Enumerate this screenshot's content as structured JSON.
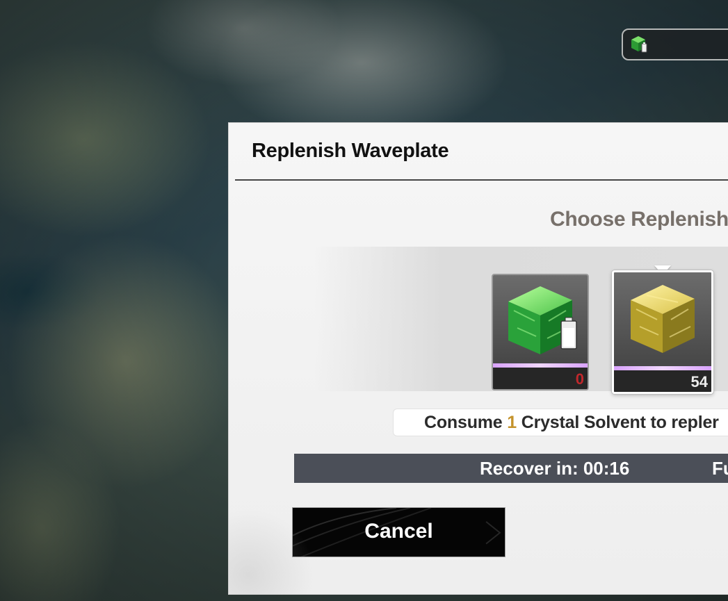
{
  "top_currency": {
    "icon": "waveplate-battery-icon"
  },
  "dialog": {
    "title": "Replenish Waveplate",
    "subtitle": "Choose Replenishr",
    "items": [
      {
        "name": "waveplate-item",
        "count": "0",
        "icon": "green-cube-battery-icon",
        "color": "#2fa33a"
      },
      {
        "name": "crystal-solvent-item",
        "count": "54",
        "icon": "yellow-crystal-cube-icon",
        "color": "#b9a42a",
        "selected": true
      }
    ],
    "consume": {
      "prefix": "Consume ",
      "qty": "1",
      "suffix": " Crystal Solvent to repler"
    },
    "recover_label": "Recover in: 00:16",
    "full_label": "Fu",
    "cancel_label": "Cancel"
  },
  "colors": {
    "accent_gold": "#c4932c",
    "count_zero": "#c0282c",
    "rarity_purple": "#d9a3ff",
    "recover_bar": "#4b4f58"
  }
}
